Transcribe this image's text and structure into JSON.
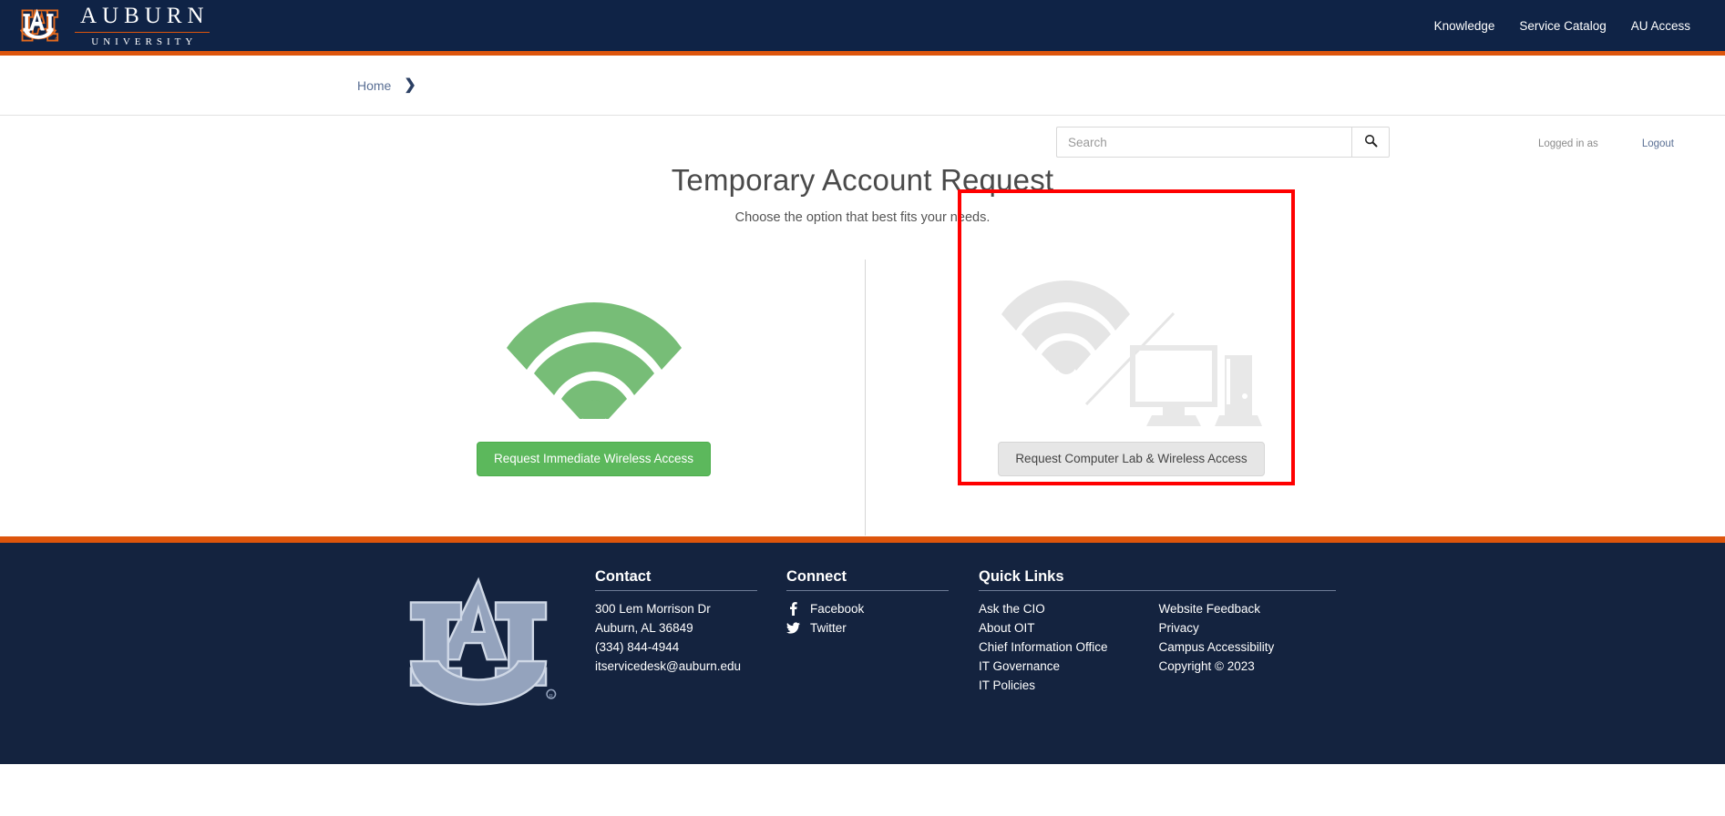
{
  "header": {
    "brand_name": "AUBURN",
    "brand_sub": "UNIVERSITY",
    "logo_icon": "auburn-au-logo-icon",
    "nav": [
      {
        "label": "Knowledge"
      },
      {
        "label": "Service Catalog"
      },
      {
        "label": "AU Access"
      }
    ]
  },
  "breadcrumb": {
    "items": [
      {
        "label": "Home"
      }
    ],
    "chevron_icon": "chevron-right-icon"
  },
  "search": {
    "value": "",
    "placeholder": "Search",
    "icon": "search-icon"
  },
  "session": {
    "logged_in_label": "Logged in as",
    "logout_label": "Logout"
  },
  "main": {
    "title": "Temporary Account Request",
    "subtitle": "Choose the option that best fits your needs.",
    "options": [
      {
        "icon": "wifi-icon",
        "icon_color": "#77bd77",
        "button_label": "Request Immediate Wireless Access",
        "button_style": "green"
      },
      {
        "icon": "wifi-disabled-computer-icon",
        "icon_color": "#e5e5e5",
        "button_label": "Request Computer Lab & Wireless Access",
        "button_style": "gray",
        "highlighted": true,
        "highlight_color": "#ff0000"
      }
    ]
  },
  "footer": {
    "logo_icon": "auburn-au-logo-icon",
    "contact": {
      "heading": "Contact",
      "lines": [
        "300 Lem Morrison Dr",
        "Auburn, AL 36849",
        "(334) 844-4944",
        "itservicedesk@auburn.edu"
      ]
    },
    "connect": {
      "heading": "Connect",
      "links": [
        {
          "label": "Facebook",
          "icon": "facebook-icon"
        },
        {
          "label": "Twitter",
          "icon": "twitter-icon"
        }
      ]
    },
    "quick_links": {
      "heading": "Quick Links",
      "col1": [
        "Ask the CIO",
        "About OIT",
        "Chief Information Office",
        "IT Governance",
        "IT Policies"
      ],
      "col2": [
        "Website Feedback",
        "Privacy",
        "Campus Accessibility",
        "Copyright © 2023"
      ]
    }
  },
  "colors": {
    "navy": "#0f2346",
    "orange": "#dd550c",
    "green": "#5cb85c",
    "footer_navy": "#14233f",
    "highlight_red": "#ff0000"
  }
}
